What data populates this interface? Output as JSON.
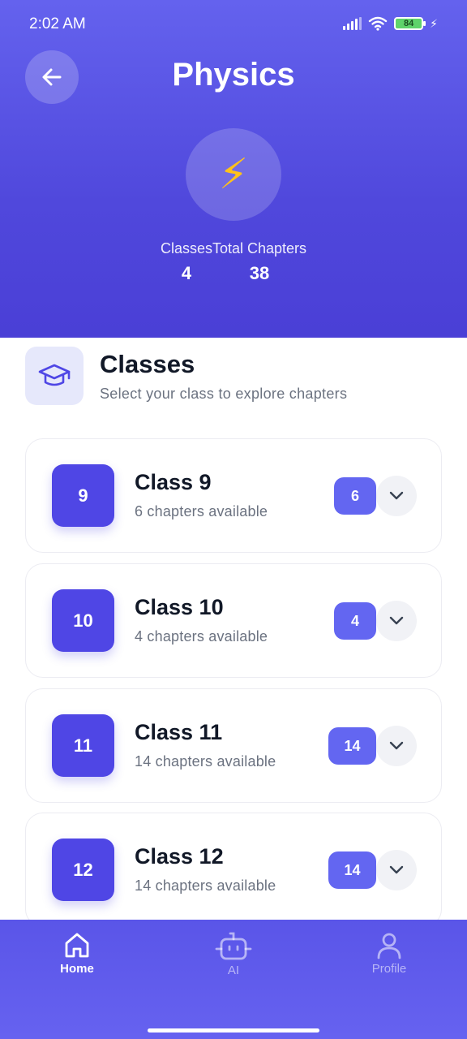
{
  "status_bar": {
    "time": "2:02 AM",
    "battery": "84"
  },
  "header": {
    "title": "Physics",
    "subject_icon": "lightning-bolt-icon",
    "stats": [
      {
        "label": "Classes",
        "value": "4"
      },
      {
        "label": "Total Chapters",
        "value": "38"
      }
    ]
  },
  "section": {
    "title": "Classes",
    "subtitle": "Select your class to explore chapters"
  },
  "classes": [
    {
      "number": "9",
      "name": "Class 9",
      "subtitle": "6 chapters available",
      "count": "6"
    },
    {
      "number": "10",
      "name": "Class 10",
      "subtitle": "4 chapters available",
      "count": "4"
    },
    {
      "number": "11",
      "name": "Class 11",
      "subtitle": "14 chapters available",
      "count": "14"
    },
    {
      "number": "12",
      "name": "Class 12",
      "subtitle": "14 chapters available",
      "count": "14"
    }
  ],
  "nav": {
    "items": [
      {
        "label": "Home",
        "icon": "home-icon",
        "active": true
      },
      {
        "label": "AI",
        "icon": "robot-icon",
        "active": false
      },
      {
        "label": "Profile",
        "icon": "person-icon",
        "active": false
      }
    ]
  },
  "colors": {
    "primary": "#4f46e5",
    "header_gradient_top": "#6462ee",
    "badge": "#6366f1"
  }
}
